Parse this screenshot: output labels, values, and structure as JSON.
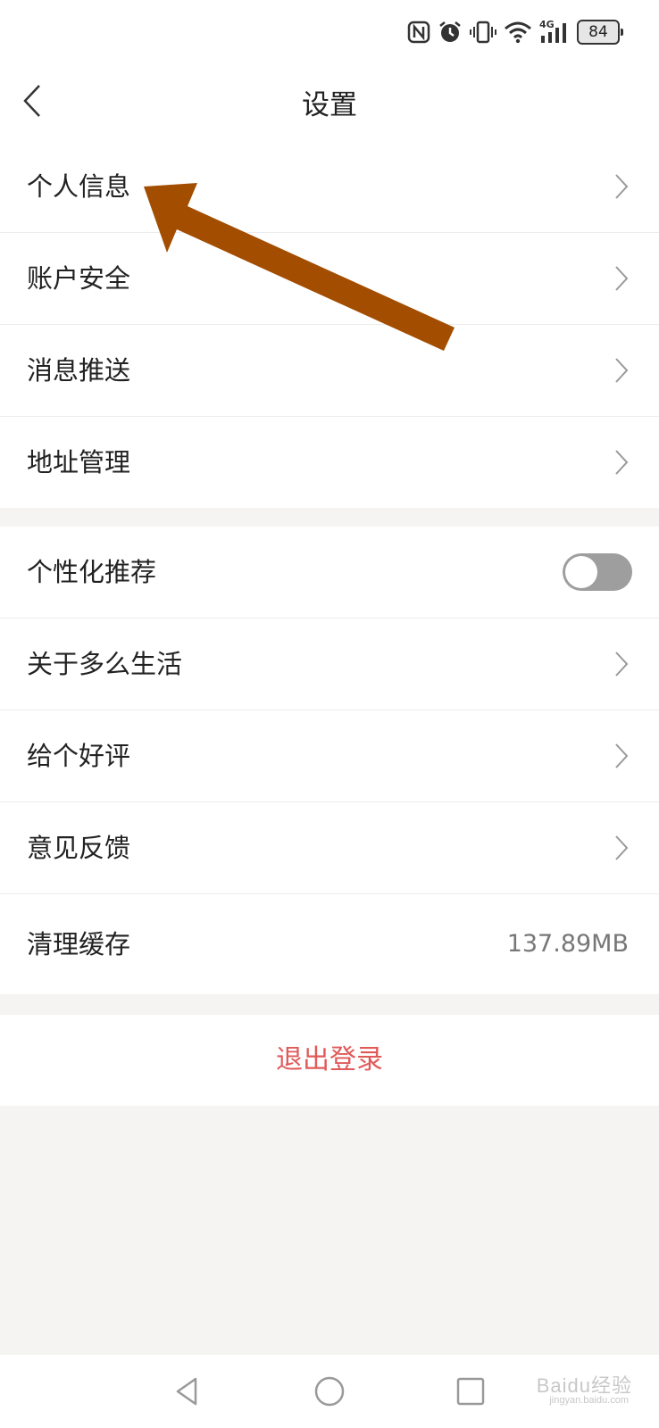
{
  "status_bar": {
    "icons": [
      "nfc-icon",
      "alarm-icon",
      "vibrate-icon",
      "wifi-icon",
      "signal-4g-icon"
    ],
    "network_label": "4G",
    "battery": "84"
  },
  "header": {
    "title": "设置"
  },
  "groups": [
    {
      "items": [
        {
          "label": "个人信息",
          "type": "link"
        },
        {
          "label": "账户安全",
          "type": "link"
        },
        {
          "label": "消息推送",
          "type": "link"
        },
        {
          "label": "地址管理",
          "type": "link"
        }
      ]
    },
    {
      "items": [
        {
          "label": "个性化推荐",
          "type": "toggle",
          "on": false
        },
        {
          "label": "关于多么生活",
          "type": "link"
        },
        {
          "label": "给个好评",
          "type": "link"
        },
        {
          "label": "意见反馈",
          "type": "link"
        },
        {
          "label": "清理缓存",
          "type": "value",
          "value": "137.89MB"
        }
      ]
    }
  ],
  "logout_label": "退出登录",
  "annotation": {
    "arrow_color": "#a34d00",
    "points_to": "个人信息"
  },
  "watermark": {
    "brand": "Baidu经验",
    "url": "jingyan.baidu.com"
  },
  "colors": {
    "logout": "#e05a5a",
    "toggle_off": "#9e9e9e"
  }
}
